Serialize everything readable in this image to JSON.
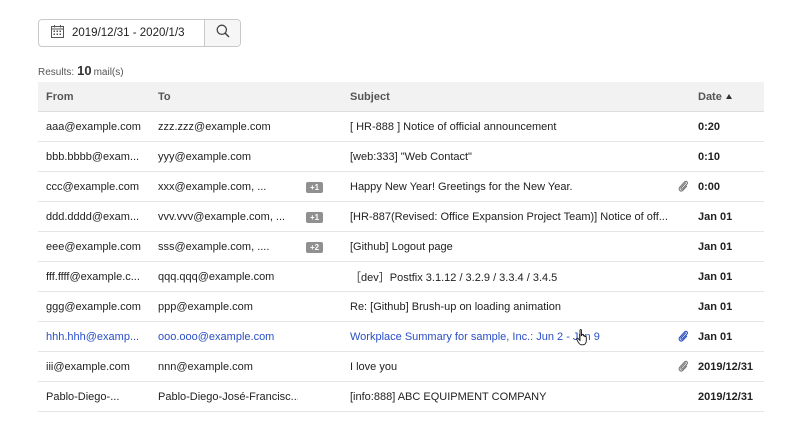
{
  "search": {
    "date_range": "2019/12/31 - 2020/1/3",
    "calendar_icon": "calendar-icon",
    "search_icon": "search-icon"
  },
  "results": {
    "label": "Results:",
    "count": "10",
    "unit": "mail(s)"
  },
  "table": {
    "headers": {
      "from": "From",
      "to": "To",
      "subject": "Subject",
      "date": "Date"
    },
    "sort": "date-ascending",
    "rows": [
      {
        "from": "aaa@example.com",
        "to": "zzz.zzz@example.com",
        "badge": "",
        "subject": "[ HR-888 ] Notice of official announcement",
        "attachment": false,
        "date": "0:20"
      },
      {
        "from": "bbb.bbbb@exam...",
        "to": "yyy@example.com",
        "badge": "",
        "subject": "[web:333] \"Web Contact\"",
        "attachment": false,
        "date": "0:10"
      },
      {
        "from": "ccc@example.com",
        "to": "xxx@example.com, ...",
        "badge": "+1",
        "subject": "Happy New Year! Greetings for the New Year.",
        "attachment": true,
        "date": "0:00"
      },
      {
        "from": "ddd.dddd@exam...",
        "to": "vvv.vvv@example.com, ...",
        "badge": "+1",
        "subject": "[HR-887(Revised: Office Expansion Project Team)] Notice of off...",
        "attachment": false,
        "date": "Jan 01"
      },
      {
        "from": "eee@example.com",
        "to": "sss@example.com, ....",
        "badge": "+2",
        "subject": "[Github] Logout page",
        "attachment": false,
        "date": "Jan 01"
      },
      {
        "from": "fff.ffff@example.c...",
        "to": "qqq.qqq@example.com",
        "badge": "",
        "subject": "［dev］Postfix 3.1.12 / 3.2.9 / 3.3.4 / 3.4.5",
        "attachment": false,
        "date": "Jan 01"
      },
      {
        "from": "ggg@example.com",
        "to": "ppp@example.com",
        "badge": "",
        "subject": "Re: [Github] Brush-up on loading animation",
        "attachment": false,
        "date": "Jan 01"
      },
      {
        "from": "hhh.hhh@examp...",
        "to": "ooo.ooo@example.com",
        "badge": "",
        "subject": "Workplace Summary for sample, Inc.: Jun 2 - Jun 9",
        "attachment": true,
        "date": "Jan 01",
        "selected": true
      },
      {
        "from": "iii@example.com",
        "to": "nnn@example.com",
        "badge": "",
        "subject": "I love you",
        "attachment": true,
        "date": "2019/12/31"
      },
      {
        "from": "Pablo-Diego-...",
        "to": "Pablo-Diego-José-Francisc...",
        "badge": "",
        "subject": "[info:888] ABC EQUIPMENT COMPANY",
        "attachment": false,
        "date": "2019/12/31"
      }
    ]
  },
  "colors": {
    "link_blue": "#2a4fc4",
    "header_bg": "#f2f2f2",
    "badge_bg": "#909090"
  }
}
